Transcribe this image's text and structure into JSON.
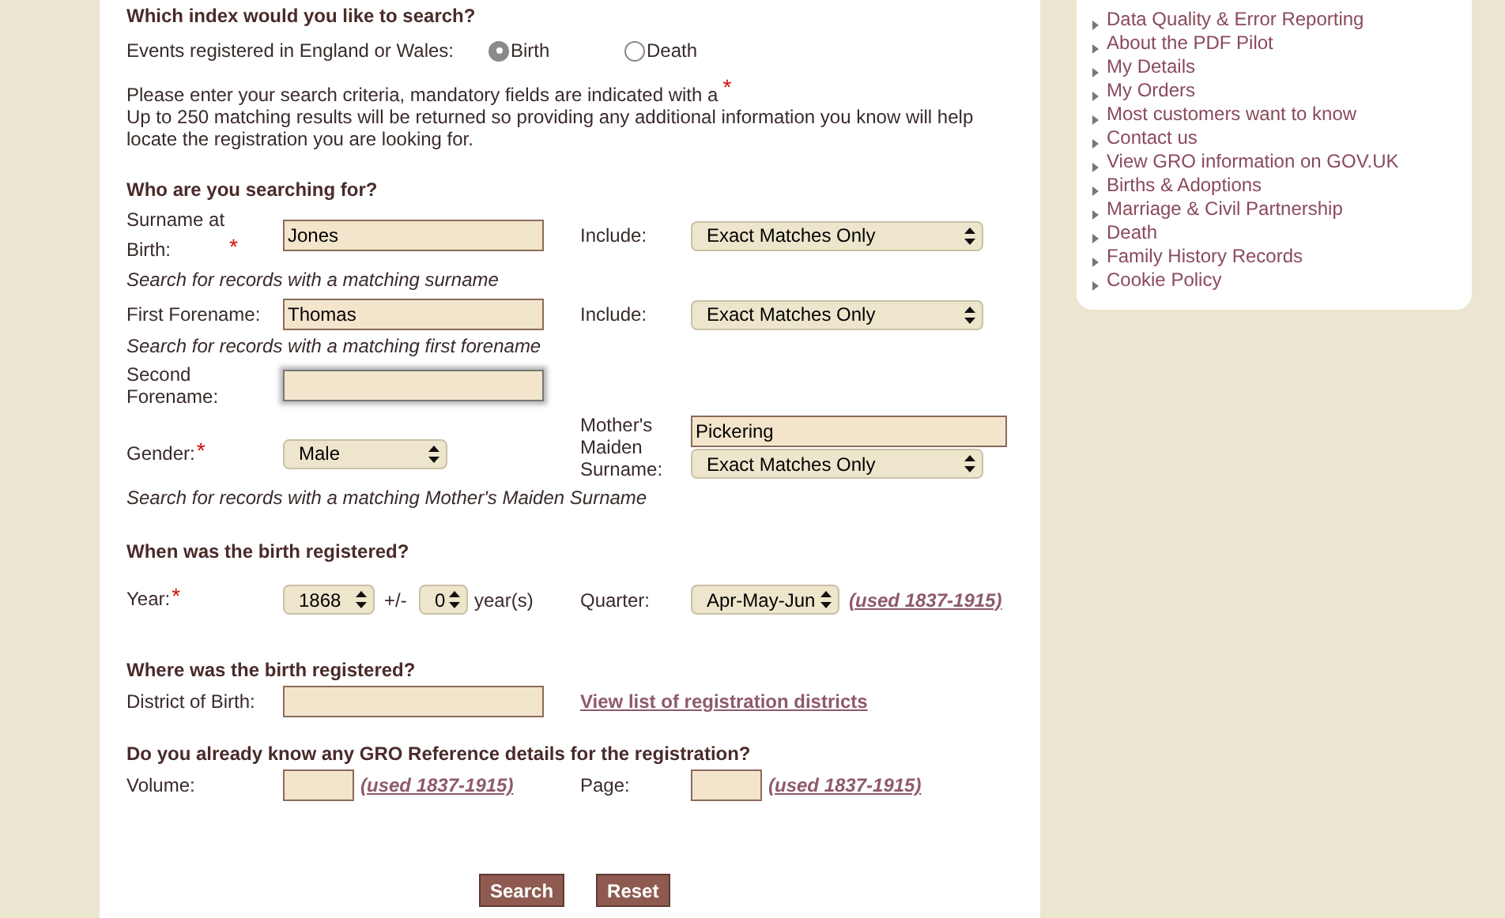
{
  "index_section": {
    "heading": "Which index would you like to search?",
    "label": "Events registered in England or Wales:",
    "options": [
      {
        "label": "Birth",
        "selected": true
      },
      {
        "label": "Death",
        "selected": false
      }
    ]
  },
  "instructions": {
    "line_1": "Please enter your search criteria, mandatory fields are indicated with a",
    "mark": "*",
    "line_2": "Up to 250 matching results will be returned so providing any additional information you know will help locate the registration you are looking for."
  },
  "who_section": {
    "heading": "Who are you searching for?",
    "surname": {
      "label": "Surname at Birth:",
      "mark": "*",
      "value": "Jones",
      "include_label": "Include:",
      "include_value": "Exact Matches Only",
      "hint": "Search for records with a matching surname"
    },
    "first_forename": {
      "label": "First Forename:",
      "value": "Thomas",
      "include_label": "Include:",
      "include_value": "Exact Matches Only",
      "hint": "Search for records with a matching first forename"
    },
    "second_forename": {
      "label": "Second Forename:",
      "focused": true
    },
    "gender": {
      "label": "Gender:",
      "mark": "*",
      "value": "Male"
    },
    "mothers_maiden_surname": {
      "label": "Mother's Maiden Surname:",
      "value": "Pickering",
      "include_value": "Exact Matches Only",
      "hint": "Search for records with a matching Mother's Maiden Surname"
    }
  },
  "when_section": {
    "heading": "When was the birth registered?",
    "year_label": "Year:",
    "mark": "*",
    "year": "1868",
    "range_label": "+/-",
    "range": "0",
    "range_unit": "year(s)",
    "quarter_label": "Quarter:",
    "quarter": "Apr-May-Jun",
    "quarter_note": "(used 1837-1915)"
  },
  "where_section": {
    "heading": "Where was the birth registered?",
    "district_label": "District of Birth:",
    "districts_link": "View list of registration districts"
  },
  "reference_section": {
    "heading": "Do you already know any GRO Reference details for the registration?",
    "volume_label": "Volume:",
    "volume_note": "(used 1837-1915)",
    "page_label": "Page:",
    "page_note": "(used 1837-1915)"
  },
  "buttons": [
    "Search",
    "Reset"
  ],
  "sidebar": {
    "items": [
      "Data Quality & Error Reporting",
      "About the PDF Pilot",
      "My Details",
      "My Orders",
      "Most customers want to know",
      "Contact us",
      "View GRO information on GOV.UK",
      "Births & Adoptions",
      "Marriage & Civil Partnership",
      "Death",
      "Family History Records",
      "Cookie Policy"
    ]
  }
}
